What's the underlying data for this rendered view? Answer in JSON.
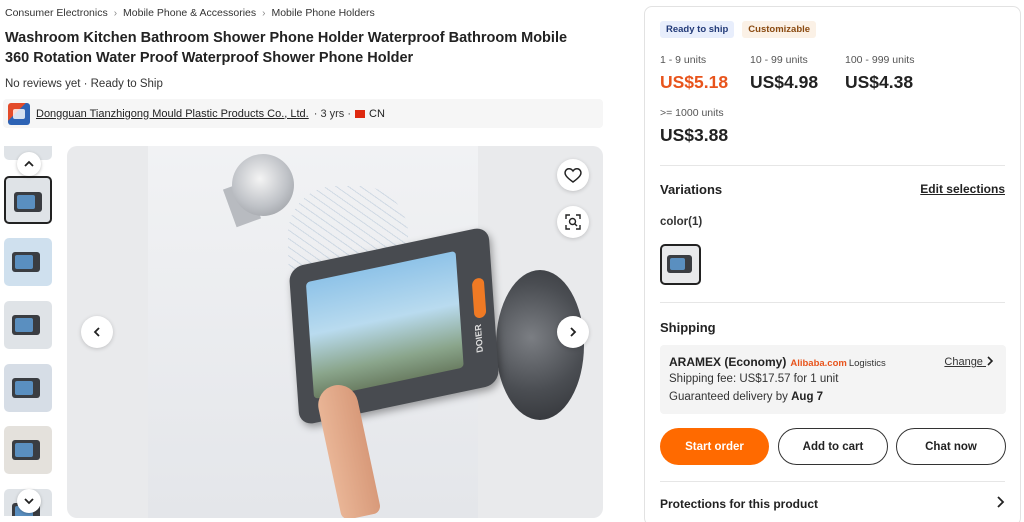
{
  "breadcrumb": [
    "Consumer Electronics",
    "Mobile Phone & Accessories",
    "Mobile Phone Holders"
  ],
  "breadcrumb_separator": "›",
  "product": {
    "title": "Washroom Kitchen Bathroom Shower Phone Holder Waterproof Bathroom Mobile 360 Rotation Water Proof Waterproof Shower Phone Holder",
    "reviews_status": "No reviews yet · Ready to Ship"
  },
  "supplier": {
    "name": "Dongguan Tianzhigong Mould Plastic Products Co., Ltd.",
    "years": "· 3 yrs ·",
    "country": "CN"
  },
  "gallery": {
    "thumbnails": 6,
    "selected_index": 1,
    "image_brand_text": "DOIER"
  },
  "panel": {
    "badges": {
      "ready": "Ready to ship",
      "customizable": "Customizable"
    },
    "tiers": [
      {
        "units": "1 - 9 units",
        "price": "US$5.18",
        "highlight": true
      },
      {
        "units": "10 - 99 units",
        "price": "US$4.98",
        "highlight": false
      },
      {
        "units": "100 - 999 units",
        "price": "US$4.38",
        "highlight": false
      },
      {
        "units": ">= 1000 units",
        "price": "US$3.88",
        "highlight": false
      }
    ],
    "variations": {
      "title": "Variations",
      "edit": "Edit selections",
      "color_label": "color(1)"
    },
    "shipping": {
      "title": "Shipping",
      "carrier": "ARAMEX (Economy)",
      "logistics_brand": "Alibaba.com",
      "logistics_word": "Logistics",
      "change": "Change",
      "fee": "Shipping fee: US$17.57 for 1 unit",
      "delivery_prefix": "Guaranteed delivery by",
      "delivery_date": "Aug 7"
    },
    "buttons": {
      "start": "Start order",
      "cart": "Add to cart",
      "chat": "Chat now"
    },
    "protections": "Protections for this product"
  },
  "colors": {
    "accent": "#ff6a00",
    "price_highlight": "#e8541c"
  },
  "icons": [
    "heart-icon",
    "image-search-icon",
    "chevron-left-icon",
    "chevron-right-icon",
    "chevron-up-icon",
    "chevron-down-icon",
    "flag-icon"
  ]
}
